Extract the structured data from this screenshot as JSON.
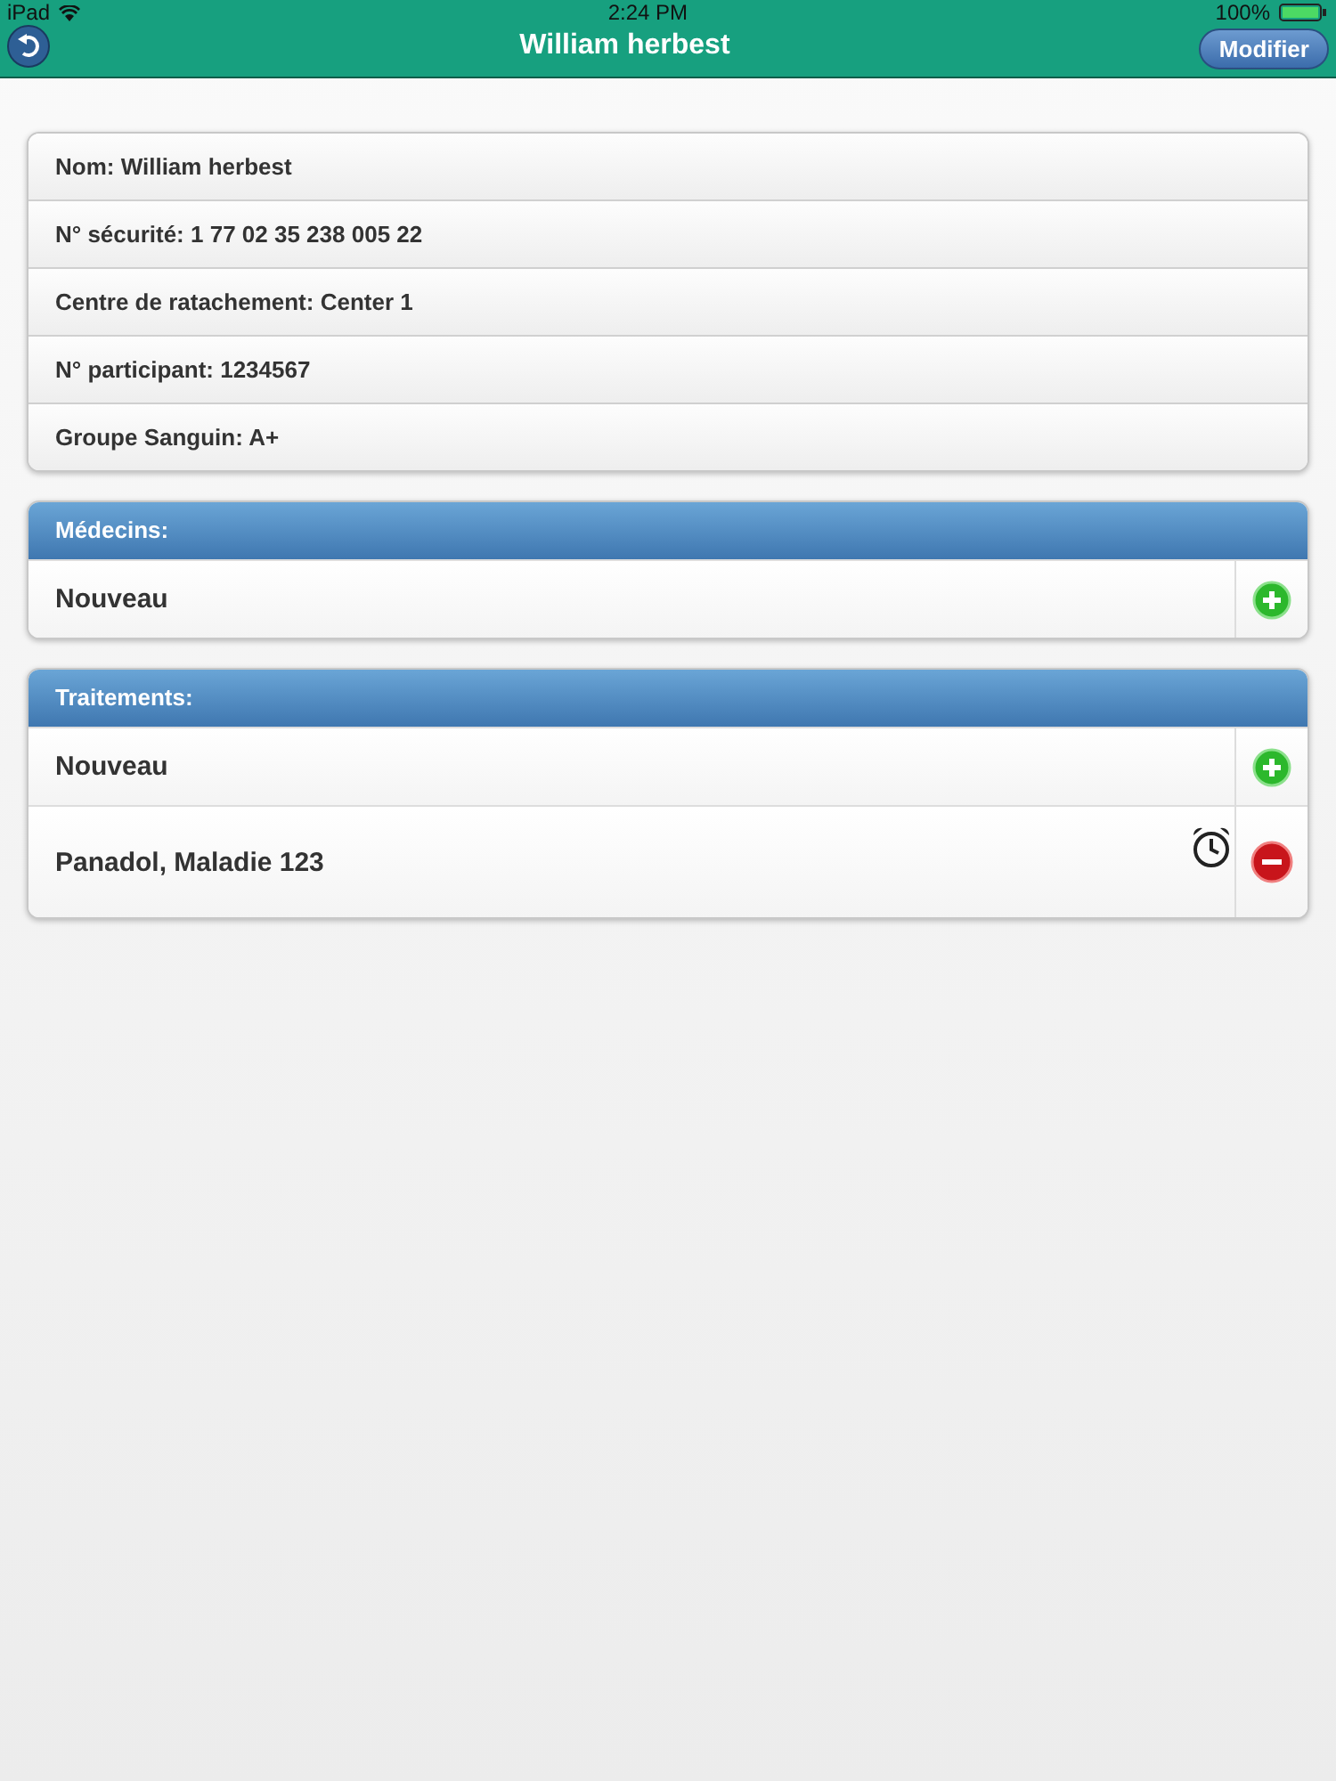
{
  "status_bar": {
    "device": "iPad",
    "time": "2:24 PM",
    "battery": "100%"
  },
  "nav": {
    "title": "William herbest",
    "right_button": "Modifier"
  },
  "info": [
    "Nom: William herbest",
    "N° sécurité: 1 77 02 35 238 005 22",
    "Centre de ratachement: Center 1",
    "N° participant: 1234567",
    "Groupe Sanguin: A+"
  ],
  "sections": [
    {
      "title": "Médecins:",
      "rows": [
        {
          "label": "Nouveau",
          "kind": "add",
          "alarm": false
        }
      ]
    },
    {
      "title": "Traitements:",
      "rows": [
        {
          "label": "Nouveau",
          "kind": "add",
          "alarm": false
        },
        {
          "label": "Panadol, Maladie 123",
          "kind": "remove",
          "alarm": true
        }
      ]
    }
  ]
}
